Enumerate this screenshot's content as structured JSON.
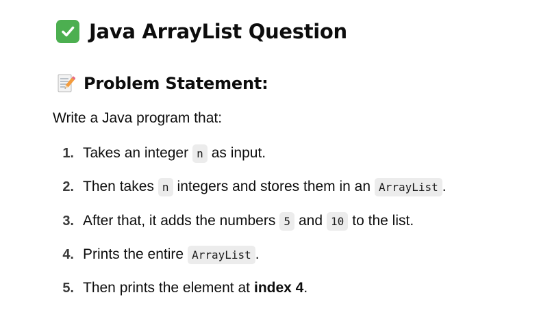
{
  "header": {
    "title": "Java ArrayList Question",
    "icon": "check-mark-button-icon"
  },
  "section": {
    "title": "Problem Statement:",
    "icon": "memo-icon"
  },
  "intro": "Write a Java program that:",
  "steps": [
    {
      "number": "1.",
      "before": "Takes an integer",
      "code1": "n",
      "after": "as input."
    },
    {
      "number": "2.",
      "before": "Then takes",
      "code1": "n",
      "middle": "integers and stores them in an",
      "code2": "ArrayList",
      "after": "."
    },
    {
      "number": "3.",
      "before": "After that, it adds the numbers",
      "code1": "5",
      "middle": "and",
      "code2": "10",
      "after": "to the list."
    },
    {
      "number": "4.",
      "before": "Prints the entire",
      "code1": "ArrayList",
      "after": "."
    },
    {
      "number": "5.",
      "before": "Then prints the element at",
      "bold": "index 4",
      "after": "."
    }
  ],
  "colors": {
    "check_green": "#4caf50",
    "code_bg": "#ececec",
    "text": "#0d0d0d"
  }
}
